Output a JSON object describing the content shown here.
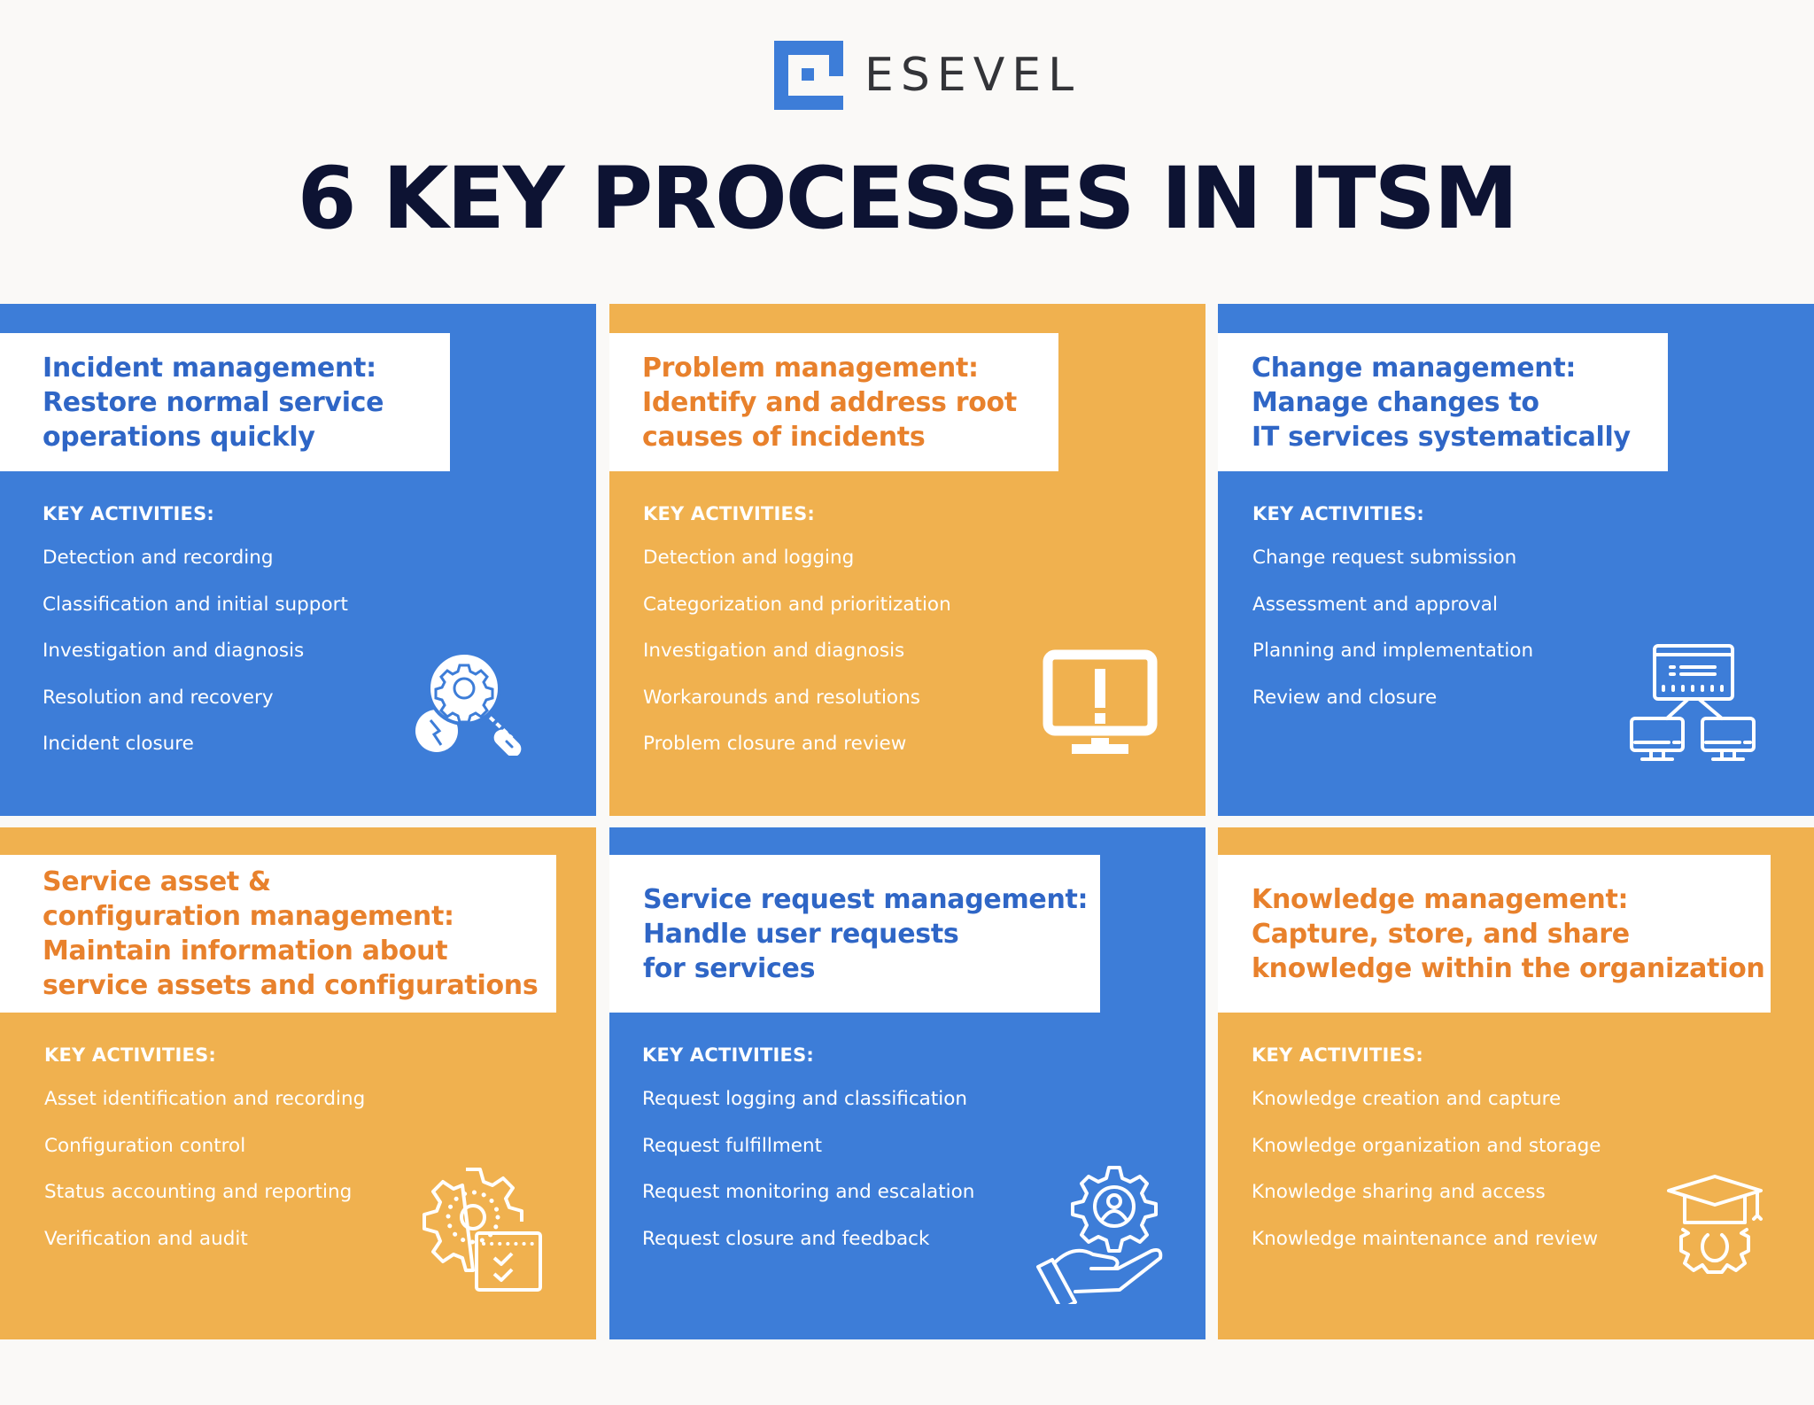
{
  "brand": {
    "name": "ESEVEL",
    "logo_icon": "esevel-logo-icon",
    "colors": {
      "blue": "#3d7dd8",
      "orange": "#f0b14f",
      "navy": "#0d1333",
      "heading_blue": "#2f66c6",
      "heading_orange": "#e8812c"
    }
  },
  "title": "6 KEY PROCESSES IN ITSM",
  "key_activities_label": "KEY ACTIVITIES:",
  "processes": [
    {
      "theme": "blue",
      "heading": "Incident management:\nRestore normal service\noperations quickly",
      "icon": "magnifier-gear-icon",
      "activities": [
        "Detection and recording",
        "Classification and initial support",
        "Investigation and diagnosis",
        "Resolution and recovery",
        "Incident closure"
      ]
    },
    {
      "theme": "orange",
      "heading": "Problem management:\nIdentify and address root\ncauses of incidents",
      "icon": "monitor-alert-icon",
      "activities": [
        "Detection and logging",
        "Categorization and prioritization",
        "Investigation and diagnosis",
        "Workarounds and resolutions",
        "Problem closure and review"
      ]
    },
    {
      "theme": "blue",
      "heading": "Change management:\nManage changes to\nIT services systematically",
      "icon": "network-computers-icon",
      "activities": [
        "Change request submission",
        "Assessment and approval",
        "Planning and implementation",
        "Review and closure"
      ]
    },
    {
      "theme": "orange",
      "heading": "Service asset &\nconfiguration management:\nMaintain information about\nservice assets and configurations",
      "icon": "gear-checklist-icon",
      "activities": [
        "Asset identification and recording",
        "Configuration control",
        "Status accounting and reporting",
        "Verification and audit"
      ]
    },
    {
      "theme": "blue",
      "heading": "Service request management:\nHandle user requests\nfor services",
      "icon": "hand-gear-user-icon",
      "activities": [
        "Request logging and classification",
        "Request fulfillment",
        "Request monitoring and escalation",
        "Request closure and feedback"
      ]
    },
    {
      "theme": "orange",
      "heading": "Knowledge management:\nCapture, store, and share\nknowledge within the organization",
      "icon": "graduation-cap-gear-icon",
      "activities": [
        "Knowledge creation and capture",
        "Knowledge organization and storage",
        "Knowledge sharing and access",
        "Knowledge maintenance and review"
      ]
    }
  ]
}
